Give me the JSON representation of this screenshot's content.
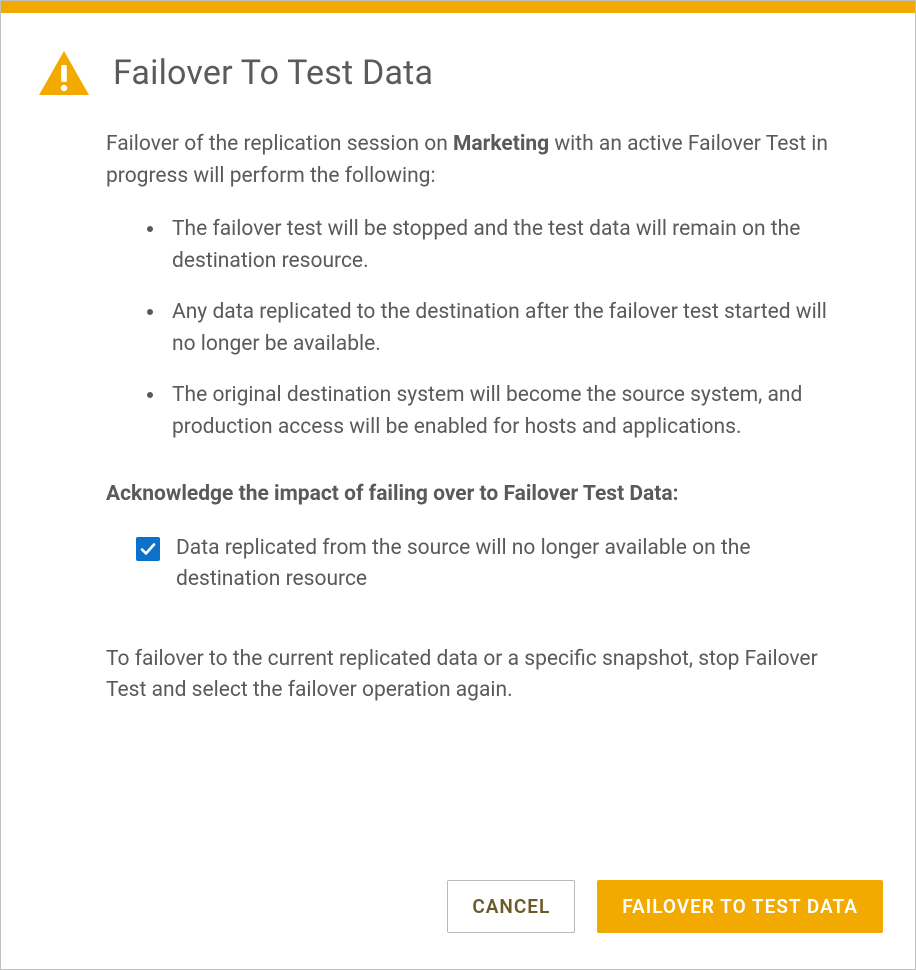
{
  "dialog": {
    "title": "Failover To Test Data",
    "intro_prefix": "Failover of the replication session on ",
    "intro_bold": "Marketing",
    "intro_suffix": " with an active Failover Test in progress will perform the following:",
    "bullets": [
      "The failover test will be stopped and the test data will remain on the destination resource.",
      "Any data replicated to the destination after the failover test started will no longer be available.",
      "The original destination system will become the source system, and production access will be enabled for hosts and applications."
    ],
    "ack_heading": "Acknowledge the impact of failing over to Failover Test Data:",
    "checkbox_label": "Data replicated from the source will no longer available on the destination resource",
    "alt_text": "To failover to the current replicated data or a specific snapshot, stop Failover Test and select the failover operation again.",
    "cancel_label": "CANCEL",
    "primary_label": "FAILOVER TO TEST DATA"
  },
  "colors": {
    "accent": "#f2a900",
    "checkbox": "#0d70c9",
    "text": "#5a5a5a"
  }
}
